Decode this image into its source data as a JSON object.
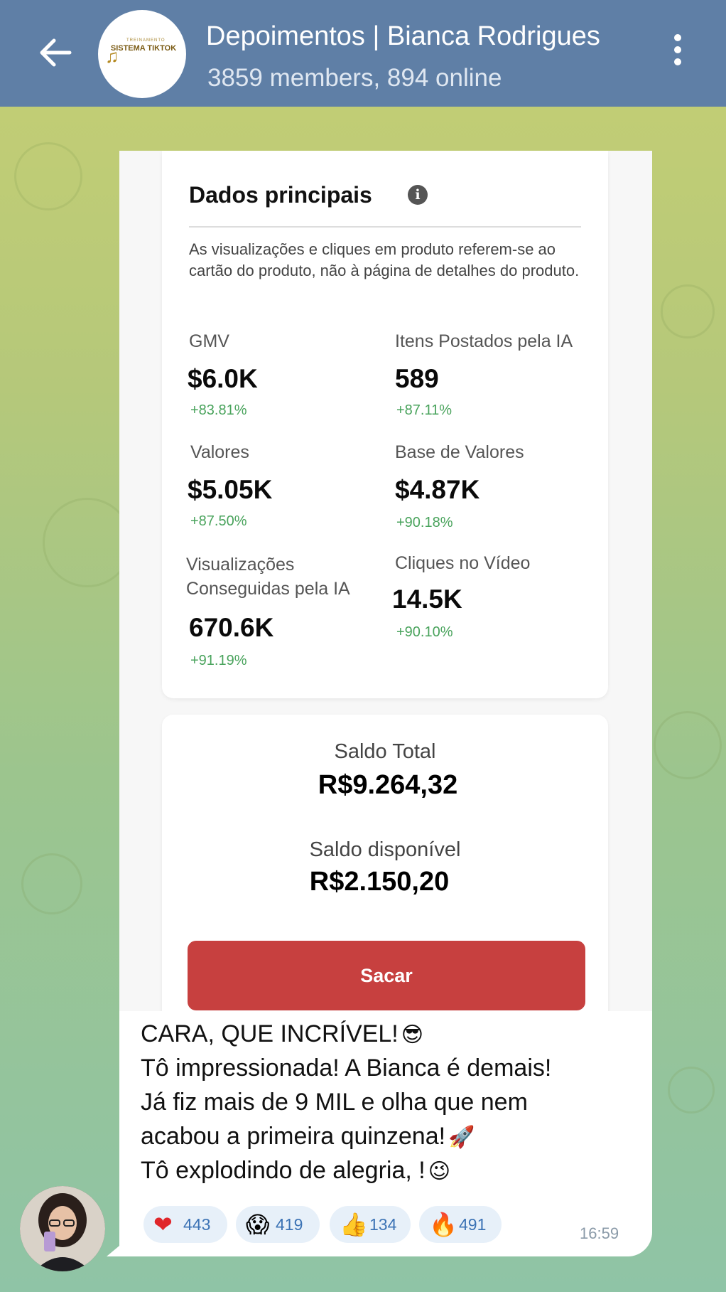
{
  "header": {
    "title": "Depoimentos | Bianca Rodrigues",
    "subtitle": "3859 members, 894 online",
    "logo_top": "TREINAMENTO",
    "logo_main": "SISTEMA TIKTOK"
  },
  "screenshot": {
    "card_title": "Dados principais",
    "description": "As visualizações e cliques em produto referem-se ao cartão do produto, não à página de detalhes do produto.",
    "metrics": [
      {
        "label": "GMV",
        "value": "$6.0K",
        "delta": "+83.81%"
      },
      {
        "label": "Itens Postados pela IA",
        "value": "589",
        "delta": "+87.11%"
      },
      {
        "label": "Valores",
        "value": "$5.05K",
        "delta": "+87.50%"
      },
      {
        "label": "Base de Valores",
        "value": "$4.87K",
        "delta": "+90.18%"
      },
      {
        "label": "Visualizações Conseguidas pela IA",
        "label_line1": "Visualizações",
        "label_line2": "Conseguidas pela IA",
        "value": "670.6K",
        "delta": "+91.19%"
      },
      {
        "label": "Cliques no Vídeo",
        "value": "14.5K",
        "delta": "+90.10%"
      }
    ],
    "balance": {
      "total_label": "Saldo Total",
      "total_value": "R$9.264,32",
      "available_label": "Saldo disponível",
      "available_value": "R$2.150,20",
      "withdraw_button": "Sacar"
    }
  },
  "message": {
    "lines": [
      "CARA, QUE INCRÍVEL!",
      "Tô impressionada! A Bianca é demais!",
      "Já fiz mais de 9 MIL e olha que nem",
      "acabou a primeira quinzena!",
      "Tô explodindo de alegria, !"
    ],
    "line_emojis": [
      "😎",
      "",
      "",
      "🚀",
      "😉"
    ],
    "time": "16:59"
  },
  "reactions": [
    {
      "emoji": "❤",
      "icon": "heart-icon",
      "count": "443"
    },
    {
      "emoji": "😱",
      "icon": "screaming-face-icon",
      "count": "419"
    },
    {
      "emoji": "👍",
      "icon": "thumbs-up-icon",
      "count": "134"
    },
    {
      "emoji": "🔥",
      "icon": "fire-icon",
      "count": "491"
    }
  ],
  "colors": {
    "header": "#5f7fa6",
    "accent_button": "#c7403f",
    "delta_green": "#49a35c",
    "reaction_bg": "#e7f0f9",
    "reaction_text": "#3c73b5"
  }
}
